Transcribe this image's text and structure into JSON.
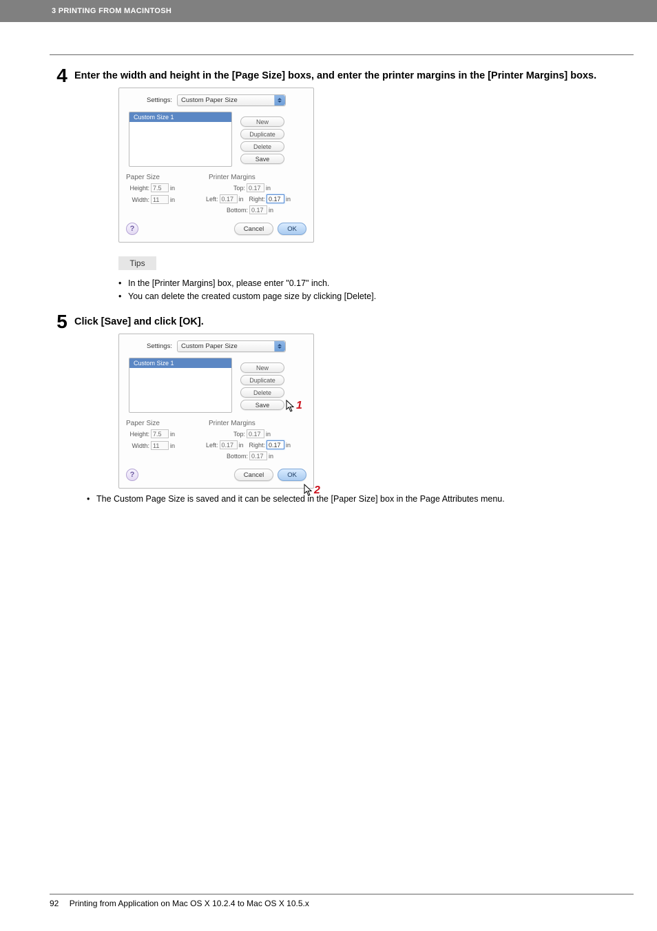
{
  "header": {
    "title": "3 PRINTING FROM MACINTOSH"
  },
  "step4": {
    "num": "4",
    "text": "Enter the width and height in the [Page Size] boxs, and enter the printer margins in the [Printer Margins] boxs."
  },
  "step5": {
    "num": "5",
    "text": "Click [Save] and click [OK]."
  },
  "dlg": {
    "settings_label": "Settings:",
    "settings_value": "Custom Paper Size",
    "list_selected": "Custom Size 1",
    "btn_new": "New",
    "btn_dup": "Duplicate",
    "btn_del": "Delete",
    "btn_save": "Save",
    "sec_size": "Paper Size",
    "sec_margins": "Printer Margins",
    "height_lbl": "Height:",
    "height_val": "7.5",
    "width_lbl": "Width:",
    "width_val": "11",
    "unit": "in",
    "top_lbl": "Top:",
    "left_lbl": "Left:",
    "right_lbl": "Right:",
    "bottom_lbl": "Bottom:",
    "top_val": "0.17",
    "left_val": "0.17",
    "right_val": "0.17",
    "bottom_val": "0.17",
    "help": "?",
    "cancel": "Cancel",
    "ok": "OK"
  },
  "tips": {
    "label": "Tips",
    "b1": "In the [Printer Margins] box, please enter \"0.17\" inch.",
    "b2": "You can delete the created custom page size by clicking [Delete]."
  },
  "ann": {
    "one": "1",
    "two": "2"
  },
  "closing": "The Custom Page Size is saved and it can be selected in the [Paper Size] box in the Page Attributes menu.",
  "footer": {
    "num": "92",
    "text": "Printing from Application on Mac OS X 10.2.4 to Mac OS X 10.5.x"
  }
}
